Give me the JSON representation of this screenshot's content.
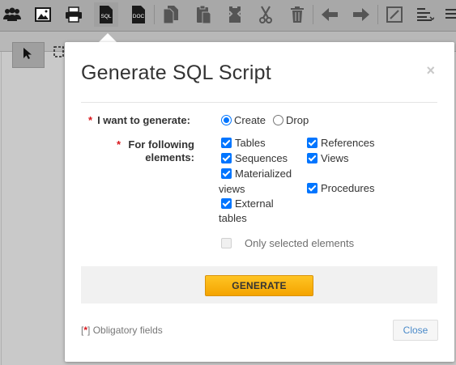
{
  "toolbar": {
    "icons": [
      "users-icon",
      "image-icon",
      "print-icon",
      "sql-icon",
      "doc-icon",
      "copy-icon",
      "paste-icon",
      "paste-special-icon",
      "cut-icon",
      "trash-icon",
      "arrow-left-icon",
      "arrow-right-icon",
      "edit-line-icon",
      "align-icon",
      "menu-icon"
    ],
    "sql_label": "SQL",
    "doc_label": "DOC"
  },
  "dialog": {
    "title": "Generate SQL Script",
    "close_glyph": "×",
    "generate_label": "I want to generate:",
    "elements_label_line1": "For following",
    "elements_label_line2": "elements:",
    "required_marker": "*",
    "radios": [
      {
        "label": "Create",
        "checked": true
      },
      {
        "label": "Drop",
        "checked": false
      }
    ],
    "checkboxes_left": [
      {
        "label": "Tables",
        "checked": true
      },
      {
        "label": "Sequences",
        "checked": true
      },
      {
        "label": "Materialized",
        "label2": "views",
        "checked": true
      },
      {
        "label": "External",
        "label2": "tables",
        "checked": true
      }
    ],
    "checkboxes_right": [
      {
        "label": "References",
        "checked": true
      },
      {
        "label": "Views",
        "checked": true
      },
      {
        "label": "Procedures",
        "checked": true
      }
    ],
    "only_selected": {
      "label": "Only selected elements",
      "checked": false
    },
    "generate_button": "GENERATE",
    "obligatory_open": "[",
    "obligatory_close": "]",
    "obligatory_text": "Obligatory fields",
    "close_button": "Close"
  },
  "colors": {
    "accent_blue": "#0075ff",
    "generate_button": "#f4a300",
    "required_red": "#d9161c",
    "close_link": "#4a8ac9"
  }
}
